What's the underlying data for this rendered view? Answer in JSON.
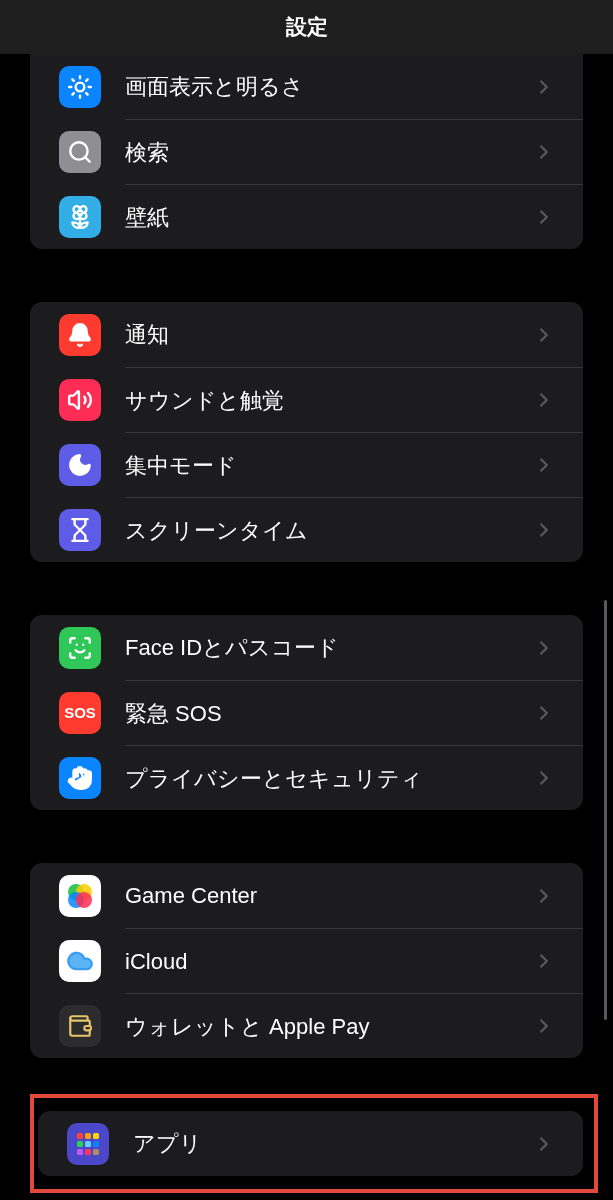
{
  "header": {
    "title": "設定"
  },
  "groups": [
    {
      "rows": [
        {
          "label": "画面表示と明るさ",
          "color": "#0a84ff"
        },
        {
          "label": "検索",
          "color": "#8e8e93"
        },
        {
          "label": "壁紙",
          "color": "#32ade6"
        }
      ]
    },
    {
      "rows": [
        {
          "label": "通知",
          "color": "#ff3b30"
        },
        {
          "label": "サウンドと触覚",
          "color": "#ff2d55"
        },
        {
          "label": "集中モード",
          "color": "#5e5ce6"
        },
        {
          "label": "スクリーンタイム",
          "color": "#5e5ce6"
        }
      ]
    },
    {
      "rows": [
        {
          "label": "Face IDとパスコード",
          "color": "#30c759"
        },
        {
          "label": "緊急 SOS",
          "color": "#ff3b30",
          "icon_text": "SOS"
        },
        {
          "label": "プライバシーとセキュリティ",
          "color": "#0a84ff"
        }
      ]
    },
    {
      "rows": [
        {
          "label": "Game Center",
          "color": "#ffffff"
        },
        {
          "label": "iCloud",
          "color": "#ffffff"
        },
        {
          "label": "ウォレットと Apple Pay",
          "color": "#2c2c2e"
        }
      ]
    },
    {
      "highlighted": true,
      "rows": [
        {
          "label": "アプリ",
          "color": "#4a47c9"
        }
      ]
    }
  ]
}
